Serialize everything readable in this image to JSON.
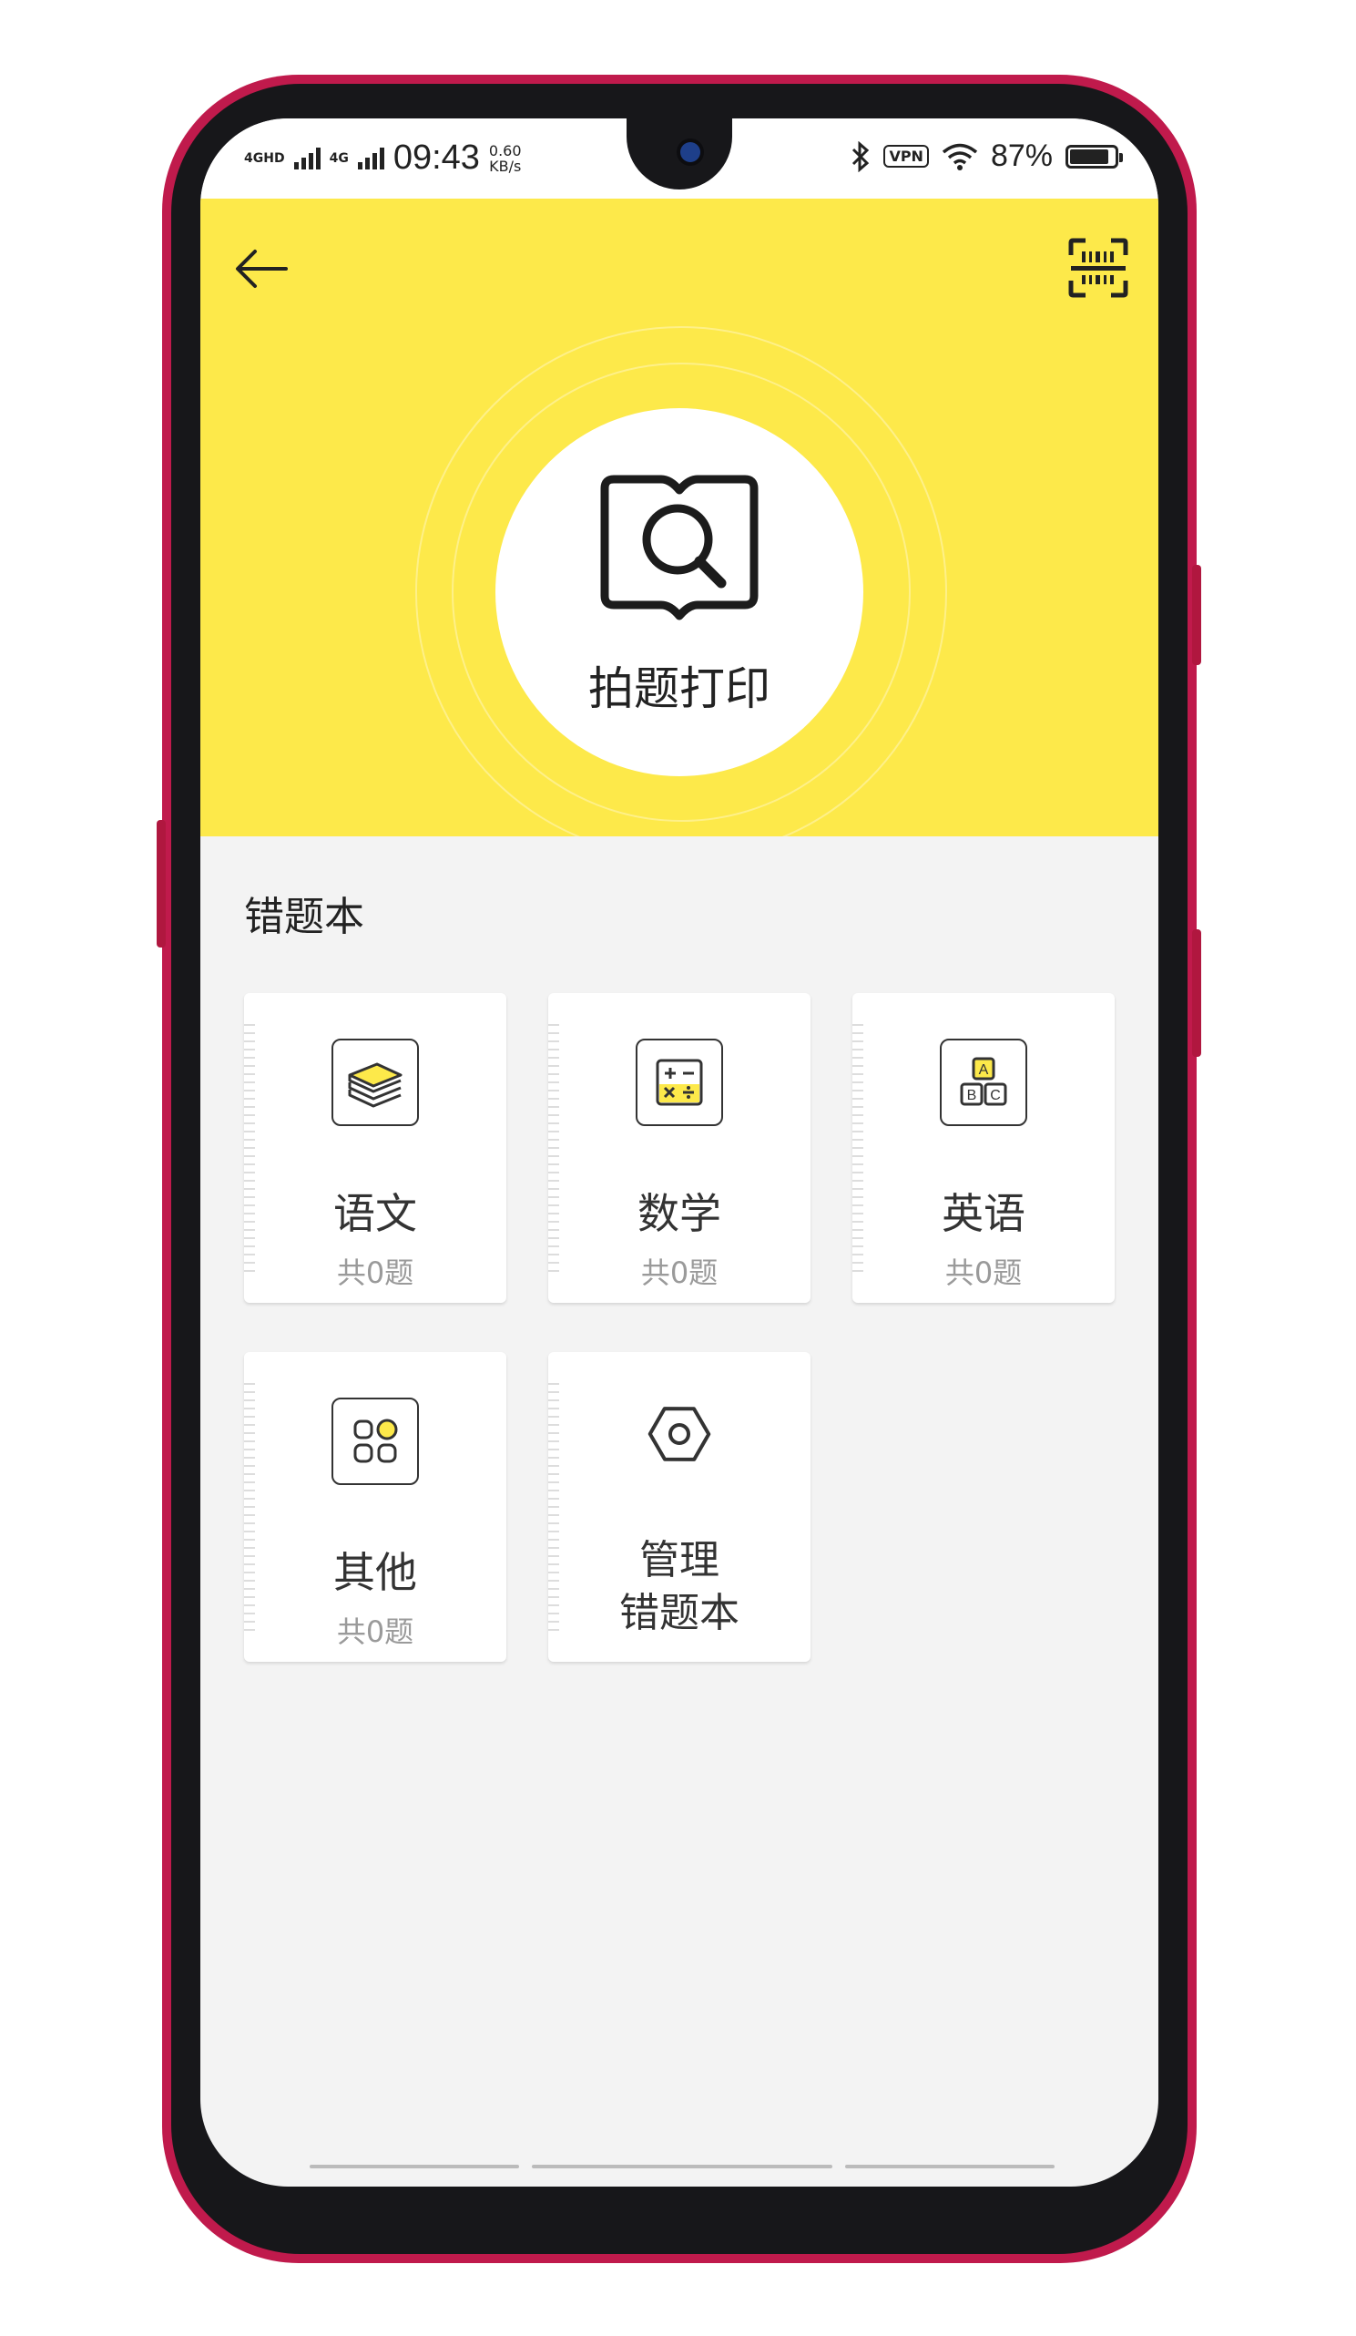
{
  "status_bar": {
    "signal_1": "4GHD",
    "signal_2": "4G",
    "time": "09:43",
    "speed_value": "0.60",
    "speed_unit": "KB/s",
    "vpn_label": "VPN",
    "battery_percent": "87%",
    "battery_level": 0.87
  },
  "header": {
    "back_icon": "arrow-left-icon",
    "scan_icon": "scan-icon",
    "action_label": "拍题打印",
    "action_icon": "book-search-icon",
    "background_color": "#fde94a"
  },
  "wrong_book": {
    "title": "错题本",
    "subjects": [
      {
        "label": "语文",
        "count": "共0题",
        "icon": "books-icon"
      },
      {
        "label": "数学",
        "count": "共0题",
        "icon": "calculator-icon"
      },
      {
        "label": "英语",
        "count": "共0题",
        "icon": "abc-blocks-icon"
      },
      {
        "label": "其他",
        "count": "共0题",
        "icon": "grid-apps-icon"
      }
    ],
    "manage": {
      "line1": "管理",
      "line2": "错题本",
      "icon": "hex-nut-icon"
    }
  }
}
